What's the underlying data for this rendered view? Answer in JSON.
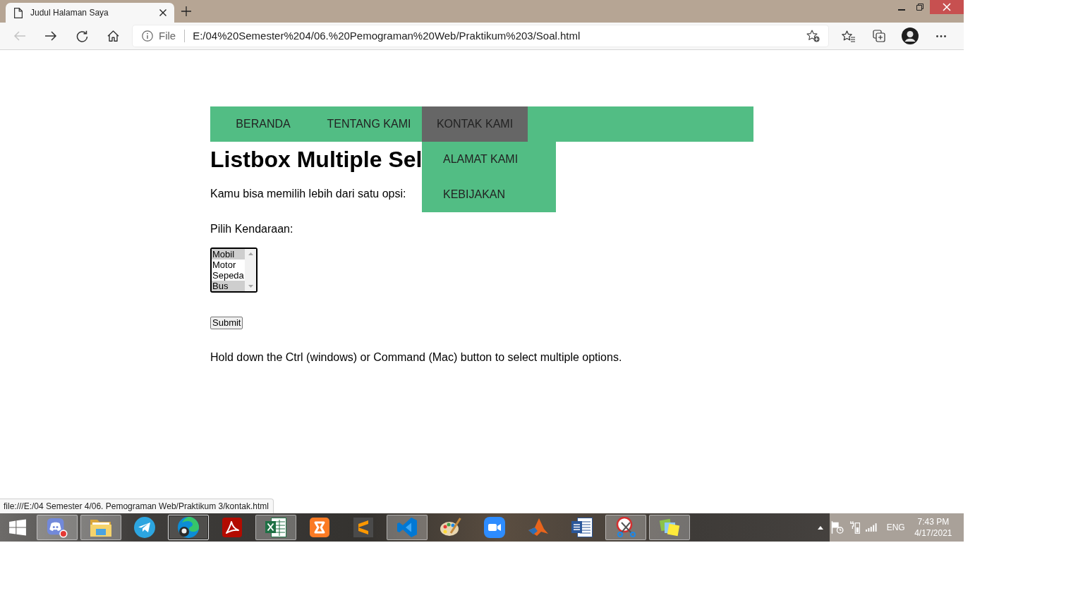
{
  "browser": {
    "tab": {
      "title": "Judul Halaman Saya"
    },
    "back": {
      "disabled": true
    },
    "forward": {
      "disabled": false
    },
    "address": {
      "scheme": "File",
      "url": "E:/04%20Semester%204/06.%20Pemograman%20Web/Praktikum%203/Soal.html"
    },
    "status_url": "file:///E:/04 Semester 4/06. Pemograman Web/Praktikum 3/kontak.html"
  },
  "page": {
    "nav": [
      {
        "label": "BERANDA",
        "expanded": false
      },
      {
        "label": "TENTANG KAMI",
        "expanded": false
      },
      {
        "label": "KONTAK KAMI",
        "expanded": true,
        "submenu": [
          {
            "label": "ALAMAT KAMI"
          },
          {
            "label": "KEBIJAKAN"
          }
        ]
      }
    ],
    "heading": "Listbox Multiple Sel",
    "intro": "Kamu bisa memilih lebih dari satu opsi:",
    "field_label": "Pilih Kendaraan:",
    "options": [
      {
        "label": "Mobil",
        "selected": true
      },
      {
        "label": "Motor",
        "selected": false
      },
      {
        "label": "Sepeda",
        "selected": false
      },
      {
        "label": "Bus",
        "selected": true
      }
    ],
    "submit": "Submit",
    "note": "Hold down the Ctrl (windows) or Command (Mac) button to select multiple options."
  },
  "taskbar": {
    "apps": [
      {
        "running": true,
        "active": false
      },
      {
        "running": true,
        "active": false
      },
      {
        "running": false,
        "active": false
      },
      {
        "running": true,
        "active": true
      },
      {
        "running": false,
        "active": false
      },
      {
        "running": true,
        "active": false
      },
      {
        "running": false,
        "active": false
      },
      {
        "running": false,
        "active": false
      },
      {
        "running": true,
        "active": false
      },
      {
        "running": false,
        "active": false
      },
      {
        "running": false,
        "active": false
      },
      {
        "running": false,
        "active": false
      },
      {
        "running": false,
        "active": false
      },
      {
        "running": true,
        "active": false
      },
      {
        "running": true,
        "active": false
      }
    ],
    "tray": {
      "language": "ENG",
      "time": "7:43 PM",
      "date": "4/17/2021"
    }
  }
}
